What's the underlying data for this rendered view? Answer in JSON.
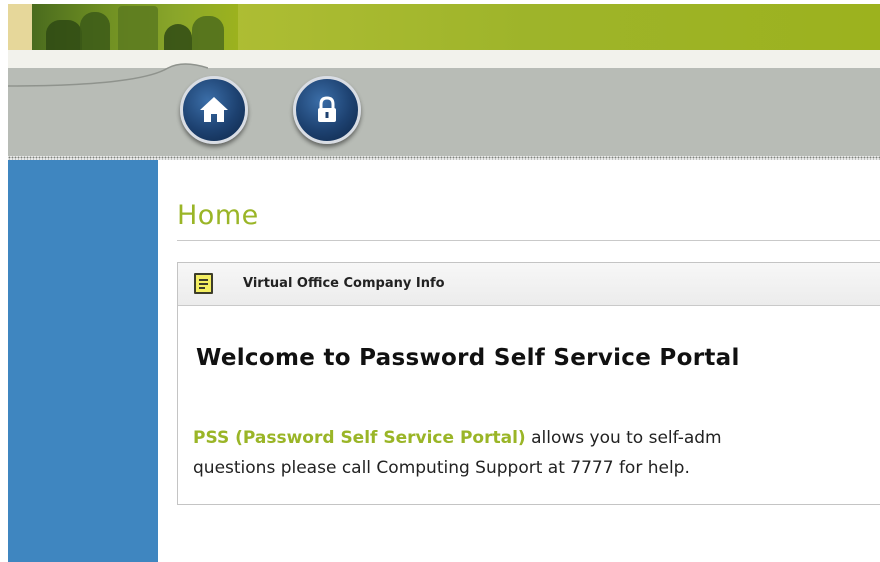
{
  "header": {
    "nav": {
      "home_icon": "home-icon",
      "lock_icon": "lock-icon"
    }
  },
  "main": {
    "title": "Home",
    "panel": {
      "heading": "Virtual Office Company Info",
      "icon": "document-icon",
      "welcome": "Welcome to Password Self Service Portal",
      "link_text": "PSS (Password Self Service Portal)",
      "line1_rest": " allows you to self-adm",
      "line2": "questions please call Computing Support at 7777 for help."
    }
  },
  "colors": {
    "accent_green": "#9ab527",
    "banner_green": "#9cb21e",
    "sidebar_blue": "#3f86c0",
    "nav_gray": "#b8bcb6",
    "button_navy": "#1d4170"
  }
}
